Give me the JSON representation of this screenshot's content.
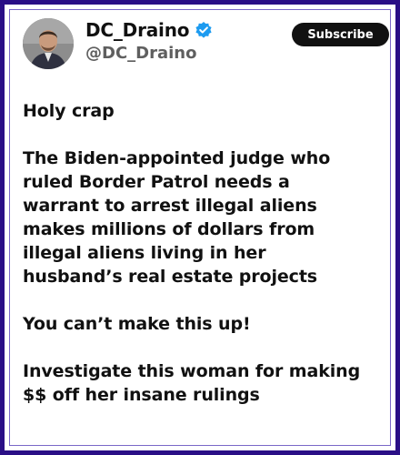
{
  "header": {
    "display_name": "DC_Draino",
    "handle": "@DC_Draino",
    "subscribe_label": "Subscribe",
    "verified_icon": "verified-badge-icon",
    "avatar_icon": "avatar"
  },
  "colors": {
    "frame_border": "#2a0f86",
    "verified_blue": "#1d9bf0",
    "subscribe_bg": "#111111",
    "text": "#111111",
    "handle_text": "#5f5f5f"
  },
  "tweet": {
    "paragraphs": [
      {
        "lines": [
          "Holy crap"
        ]
      },
      {
        "lines": [
          "The Biden-appointed judge who",
          "ruled Border Patrol needs a",
          "warrant to arrest illegal aliens",
          "makes millions of dollars from",
          "illegal aliens living in her",
          "husband’s real estate projects"
        ]
      },
      {
        "lines": [
          "You can’t make this up!"
        ]
      },
      {
        "lines": [
          "Investigate this woman for making",
          "$$ off her insane rulings"
        ]
      }
    ]
  }
}
